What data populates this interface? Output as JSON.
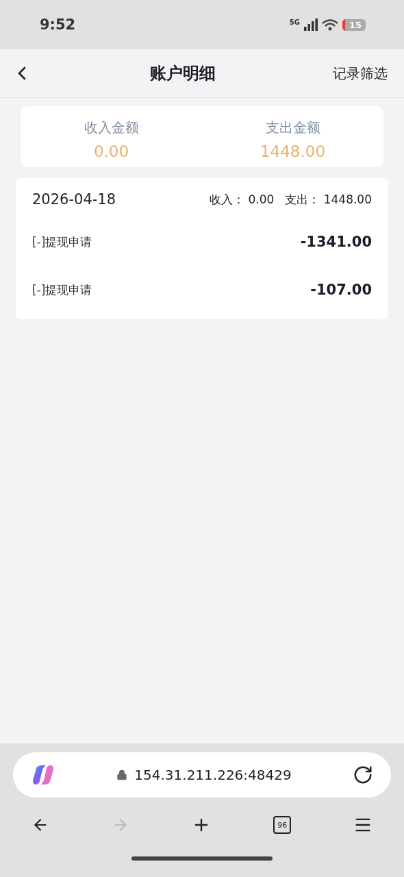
{
  "status_bar": {
    "time": "9:52",
    "network": "5G",
    "battery": "15"
  },
  "header": {
    "title": "账户明细",
    "action": "记录筛选"
  },
  "summary": [
    {
      "label": "收入金额",
      "value": "0.00"
    },
    {
      "label": "支出金额",
      "value": "1448.00"
    }
  ],
  "days": [
    {
      "date": "2026-04-18",
      "totals": [
        {
          "label": "收入：",
          "value": "0.00"
        },
        {
          "label": "支出：",
          "value": "1448.00"
        }
      ],
      "rows": [
        {
          "title": "[-]提现申请",
          "amount": "-1341.00"
        },
        {
          "title": "[-]提现申请",
          "amount": "-107.00"
        }
      ]
    }
  ],
  "browser": {
    "url": "154.31.211.226:48429",
    "nav": [
      {
        "kind": "back",
        "disabled": false
      },
      {
        "kind": "forward",
        "disabled": true
      },
      {
        "kind": "new-tab",
        "disabled": false
      },
      {
        "kind": "tabs",
        "count": "96",
        "disabled": false
      },
      {
        "kind": "menu",
        "disabled": false
      }
    ]
  }
}
